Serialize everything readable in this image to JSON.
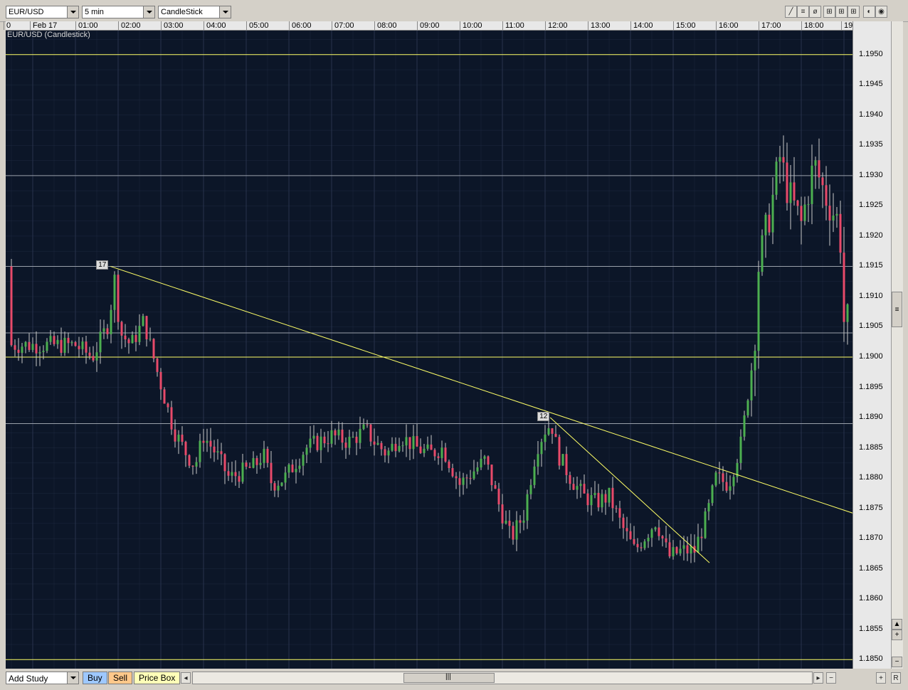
{
  "toolbar": {
    "symbol": "EUR/USD",
    "interval": "5 min",
    "chart_style": "CandleStick"
  },
  "chart": {
    "legend": "EUR/USD (Candlestick)",
    "date_label": "Feb 17",
    "trend_marker_1": "17",
    "trend_marker_2": "12",
    "colors": {
      "background": "#0c1628",
      "grid": "#2a3550",
      "up": "#4caf50",
      "down": "#e84a6a",
      "wick": "#c8c8c8",
      "trendline": "#ffff66"
    }
  },
  "chart_data": {
    "type": "candlestick",
    "x_ticks": [
      "0",
      "Feb 17",
      "01:00",
      "02:00",
      "03:00",
      "04:00",
      "05:00",
      "06:00",
      "07:00",
      "08:00",
      "09:00",
      "10:00",
      "11:00",
      "12:00",
      "13:00",
      "14:00",
      "15:00",
      "16:00",
      "17:00",
      "18:00",
      "19"
    ],
    "y_ticks": [
      "1.1950",
      "1.1945",
      "1.1940",
      "1.1935",
      "1.1930",
      "1.1925",
      "1.1920",
      "1.1915",
      "1.1910",
      "1.1905",
      "1.1900",
      "1.1895",
      "1.1890",
      "1.1885",
      "1.1880",
      "1.1875",
      "1.1870",
      "1.1865",
      "1.1860",
      "1.1855",
      "1.1850"
    ],
    "ylim": [
      1.18485,
      1.19555
    ],
    "horizontal_lines_yellow": [
      1.195,
      1.19,
      1.185
    ],
    "horizontal_lines_gray": [
      1.193,
      1.1915,
      1.1904,
      1.1889
    ],
    "trendlines": [
      {
        "from_time": 0.82,
        "from_price": 1.1915,
        "to_time": 19.15,
        "to_price": 1.1872
      },
      {
        "from_time": 11.12,
        "from_price": 1.189,
        "to_time": 14.85,
        "to_price": 1.1866
      }
    ],
    "path": [
      [
        0,
        1.1902
      ],
      [
        0.4,
        1.19
      ],
      [
        0.8,
        1.1906
      ],
      [
        0.9,
        1.1914
      ],
      [
        1.05,
        1.1904
      ],
      [
        1.3,
        1.1902
      ],
      [
        1.6,
        1.1906
      ],
      [
        1.9,
        1.1898
      ],
      [
        2.1,
        1.1893
      ],
      [
        2.3,
        1.1888
      ],
      [
        2.6,
        1.1884
      ],
      [
        2.8,
        1.1882
      ],
      [
        3.0,
        1.1887
      ],
      [
        3.3,
        1.1884
      ],
      [
        3.6,
        1.188
      ],
      [
        3.9,
        1.1881
      ],
      [
        4.2,
        1.1882
      ],
      [
        4.4,
        1.1884
      ],
      [
        4.6,
        1.1879
      ],
      [
        4.9,
        1.188
      ],
      [
        5.1,
        1.1882
      ],
      [
        5.4,
        1.1885
      ],
      [
        5.7,
        1.1886
      ],
      [
        6.0,
        1.1887
      ],
      [
        6.4,
        1.1886
      ],
      [
        6.8,
        1.1888
      ],
      [
        7.0,
        1.1886
      ],
      [
        7.3,
        1.1884
      ],
      [
        7.6,
        1.1887
      ],
      [
        8.0,
        1.1885
      ],
      [
        8.3,
        1.1884
      ],
      [
        8.6,
        1.1885
      ],
      [
        9.0,
        1.1879
      ],
      [
        9.3,
        1.1881
      ],
      [
        9.6,
        1.1883
      ],
      [
        9.9,
        1.1876
      ],
      [
        10.2,
        1.187
      ],
      [
        10.5,
        1.1874
      ],
      [
        10.8,
        1.1885
      ],
      [
        11.0,
        1.1888
      ],
      [
        11.15,
        1.1889
      ],
      [
        11.3,
        1.1884
      ],
      [
        11.6,
        1.188
      ],
      [
        11.9,
        1.1877
      ],
      [
        12.2,
        1.1876
      ],
      [
        12.5,
        1.1877
      ],
      [
        12.8,
        1.1872
      ],
      [
        13.1,
        1.1868
      ],
      [
        13.4,
        1.1871
      ],
      [
        13.6,
        1.1873
      ],
      [
        13.9,
        1.1867
      ],
      [
        14.2,
        1.1868
      ],
      [
        14.5,
        1.1868
      ],
      [
        14.8,
        1.1874
      ],
      [
        15.0,
        1.188
      ],
      [
        15.3,
        1.1879
      ],
      [
        15.6,
        1.1886
      ],
      [
        15.9,
        1.1902
      ],
      [
        16.0,
        1.1915
      ],
      [
        16.3,
        1.1925
      ],
      [
        16.5,
        1.1933
      ],
      [
        16.7,
        1.1927
      ],
      [
        17.0,
        1.1922
      ],
      [
        17.3,
        1.1932
      ],
      [
        17.6,
        1.1926
      ],
      [
        17.9,
        1.1922
      ],
      [
        18.0,
        1.1906
      ],
      [
        18.2,
        1.1906
      ],
      [
        18.5,
        1.1897
      ],
      [
        18.6,
        1.188
      ],
      [
        18.8,
        1.189
      ],
      [
        18.9,
        1.1883
      ],
      [
        19.1,
        1.191
      ],
      [
        19.25,
        1.1915
      ]
    ]
  },
  "bottom": {
    "add_study": "Add Study",
    "buy": "Buy",
    "sell": "Sell",
    "price_box": "Price Box",
    "reset": "R"
  }
}
